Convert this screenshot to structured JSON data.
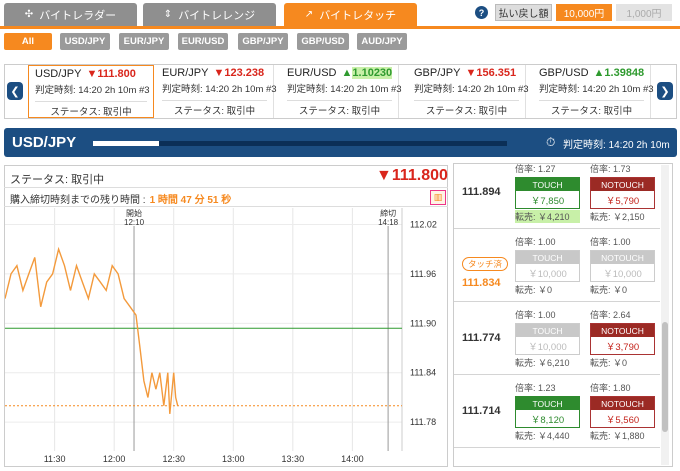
{
  "mode_tabs": [
    {
      "label": "バイトレラダー",
      "active": false
    },
    {
      "label": "バイトレレンジ",
      "active": false
    },
    {
      "label": "バイトレタッチ",
      "active": true
    }
  ],
  "payout": {
    "label": "払い戻し額",
    "options": [
      "10,000円",
      "1,000円"
    ],
    "selected": "10,000円"
  },
  "filters": [
    "All",
    "USD/JPY",
    "EUR/JPY",
    "EUR/USD",
    "GBP/JPY",
    "GBP/USD",
    "AUD/JPY"
  ],
  "cards": [
    {
      "pair": "USD/JPY",
      "rate": "111.800",
      "dir": "down",
      "time": "判定時刻: 14:20 2h 10m #3",
      "status": "ステータス: 取引中"
    },
    {
      "pair": "EUR/JPY",
      "rate": "123.238",
      "dir": "down",
      "time": "判定時刻: 14:20 2h 10m #3",
      "status": "ステータス: 取引中"
    },
    {
      "pair": "EUR/USD",
      "rate": "1.10230",
      "dir": "up",
      "time": "判定時刻: 14:20 2h 10m #3",
      "status": "ステータス: 取引中"
    },
    {
      "pair": "GBP/JPY",
      "rate": "156.351",
      "dir": "down",
      "time": "判定時刻: 14:20 2h 10m #3",
      "status": "ステータス: 取引中"
    },
    {
      "pair": "GBP/USD",
      "rate": "1.39848",
      "dir": "up",
      "time": "判定時刻: 14:20 2h 10m #3",
      "status": "ステータス: 取引中"
    }
  ],
  "header": {
    "pair": "USD/JPY",
    "judge_time": "判定時刻: 14:20 2h 10m",
    "progress": 0.16
  },
  "detail": {
    "status": "ステータス: 取引中",
    "price": "111.800",
    "remaining_label": "購入締切時刻までの残り時間 :",
    "remaining_value": "1 時間 47 分 51 秒"
  },
  "chart_data": {
    "type": "line",
    "x_ticks": [
      "11:30",
      "12:00",
      "12:30",
      "13:00",
      "13:30",
      "14:00"
    ],
    "y_ticks": [
      112.02,
      111.96,
      111.9,
      111.84,
      111.78
    ],
    "ylim": [
      111.745,
      112.04
    ],
    "xlim": [
      "11:05",
      "14:25"
    ],
    "annotations": [
      {
        "label": "開始",
        "time": "12:10"
      },
      {
        "label": "締切",
        "time": "14:18"
      }
    ],
    "series": [
      {
        "values": [
          [
            "11:05",
            111.93
          ],
          [
            "11:08",
            111.96
          ],
          [
            "11:11",
            111.97
          ],
          [
            "11:14",
            111.94
          ],
          [
            "11:17",
            111.96
          ],
          [
            "11:20",
            111.98
          ],
          [
            "11:23",
            111.92
          ],
          [
            "11:26",
            111.95
          ],
          [
            "11:29",
            111.96
          ],
          [
            "11:32",
            111.99
          ],
          [
            "11:35",
            111.97
          ],
          [
            "11:38",
            111.94
          ],
          [
            "11:41",
            111.97
          ],
          [
            "11:44",
            111.95
          ],
          [
            "11:47",
            111.93
          ],
          [
            "11:50",
            111.96
          ],
          [
            "11:53",
            111.95
          ],
          [
            "11:56",
            111.94
          ],
          [
            "11:59",
            111.97
          ],
          [
            "12:02",
            111.96
          ],
          [
            "12:05",
            111.93
          ],
          [
            "12:08",
            111.92
          ],
          [
            "12:11",
            111.91
          ],
          [
            "12:13",
            111.87
          ],
          [
            "12:15",
            111.83
          ],
          [
            "12:17",
            111.81
          ],
          [
            "12:19",
            111.84
          ],
          [
            "12:21",
            111.82
          ],
          [
            "12:23",
            111.84
          ],
          [
            "12:25",
            111.8
          ],
          [
            "12:27",
            111.84
          ],
          [
            "12:28",
            111.79
          ],
          [
            "12:30",
            111.84
          ],
          [
            "12:31",
            111.81
          ],
          [
            "12:32",
            111.8
          ]
        ]
      }
    ],
    "ref_lines": [
      {
        "value": 111.894,
        "style": "solid",
        "color": "#2e9a2e"
      },
      {
        "value": 111.8,
        "style": "dashed",
        "color": "#f6891f"
      }
    ]
  },
  "strikes": [
    {
      "price": "111.894",
      "taken": false,
      "touch": {
        "rate": "倍率: 1.27",
        "label": "TOUCH",
        "amount": "￥7,850",
        "state": "touch",
        "sell": "転売: ￥4,210",
        "sell_hl": true
      },
      "notouch": {
        "rate": "倍率: 1.73",
        "label": "NOTOUCH",
        "amount": "￥5,790",
        "state": "notouch",
        "sell": "転売: ￥2,150",
        "sell_hl": false
      }
    },
    {
      "price": "111.834",
      "taken": true,
      "taken_label": "タッチ済",
      "touch": {
        "rate": "倍率: 1.00",
        "label": "TOUCH",
        "amount": "￥10,000",
        "state": "dis",
        "sell": "転売: ￥0",
        "sell_hl": false
      },
      "notouch": {
        "rate": "倍率: 1.00",
        "label": "NOTOUCH",
        "amount": "￥10,000",
        "state": "dis",
        "sell": "転売: ￥0",
        "sell_hl": false
      }
    },
    {
      "price": "111.774",
      "taken": false,
      "touch": {
        "rate": "倍率: 1.00",
        "label": "TOUCH",
        "amount": "￥10,000",
        "state": "dis",
        "sell": "転売: ￥6,210",
        "sell_hl": false
      },
      "notouch": {
        "rate": "倍率: 2.64",
        "label": "NOTOUCH",
        "amount": "￥3,790",
        "state": "notouch",
        "sell": "転売: ￥0",
        "sell_hl": false
      }
    },
    {
      "price": "111.714",
      "taken": false,
      "touch": {
        "rate": "倍率: 1.23",
        "label": "TOUCH",
        "amount": "￥8,120",
        "state": "touch",
        "sell": "転売: ￥4,440",
        "sell_hl": false
      },
      "notouch": {
        "rate": "倍率: 1.80",
        "label": "NOTOUCH",
        "amount": "￥5,560",
        "state": "notouch",
        "sell": "転売: ￥1,880",
        "sell_hl": false
      }
    }
  ]
}
